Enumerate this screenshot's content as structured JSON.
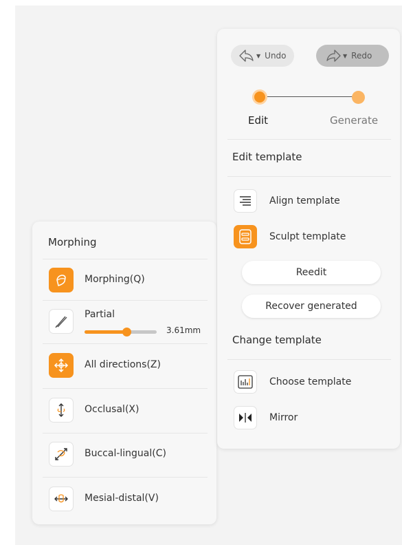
{
  "colors": {
    "accent": "#f7931e",
    "accent_light": "#fbb563",
    "panel_bg": "#f7f7f7",
    "page_bg": "#f3f3f3"
  },
  "morphing_panel": {
    "title": "Morphing",
    "items": [
      {
        "label": "Morphing(Q)",
        "icon": "morphing-icon",
        "active": true
      },
      {
        "label": "Partial",
        "icon": "partial-brush-icon",
        "active": false
      },
      {
        "label": "All directions(Z)",
        "icon": "all-directions-icon",
        "active": true
      },
      {
        "label": "Occlusal(X)",
        "icon": "occlusal-icon",
        "active": false
      },
      {
        "label": "Buccal-lingual(C)",
        "icon": "buccal-lingual-icon",
        "active": false
      },
      {
        "label": "Mesial-distal(V)",
        "icon": "mesial-distal-icon",
        "active": false
      }
    ],
    "partial_slider": {
      "value_text": "3.61mm",
      "fraction": 0.58
    }
  },
  "edit_panel": {
    "undo_label": "Undo",
    "redo_label": "Redo",
    "steps": [
      {
        "label": "Edit",
        "active": true
      },
      {
        "label": "Generate",
        "active": false
      }
    ],
    "edit_template_heading": "Edit template",
    "edit_items": [
      {
        "label": "Align template",
        "icon": "align-lines-icon",
        "active": false
      },
      {
        "label": "Sculpt template",
        "icon": "sculpt-template-icon",
        "active": true
      }
    ],
    "reedit_label": "Reedit",
    "recover_label": "Recover generated",
    "change_template_heading": "Change template",
    "change_items": [
      {
        "label": "Choose template",
        "icon": "choose-template-icon"
      },
      {
        "label": "Mirror",
        "icon": "mirror-icon"
      }
    ]
  }
}
